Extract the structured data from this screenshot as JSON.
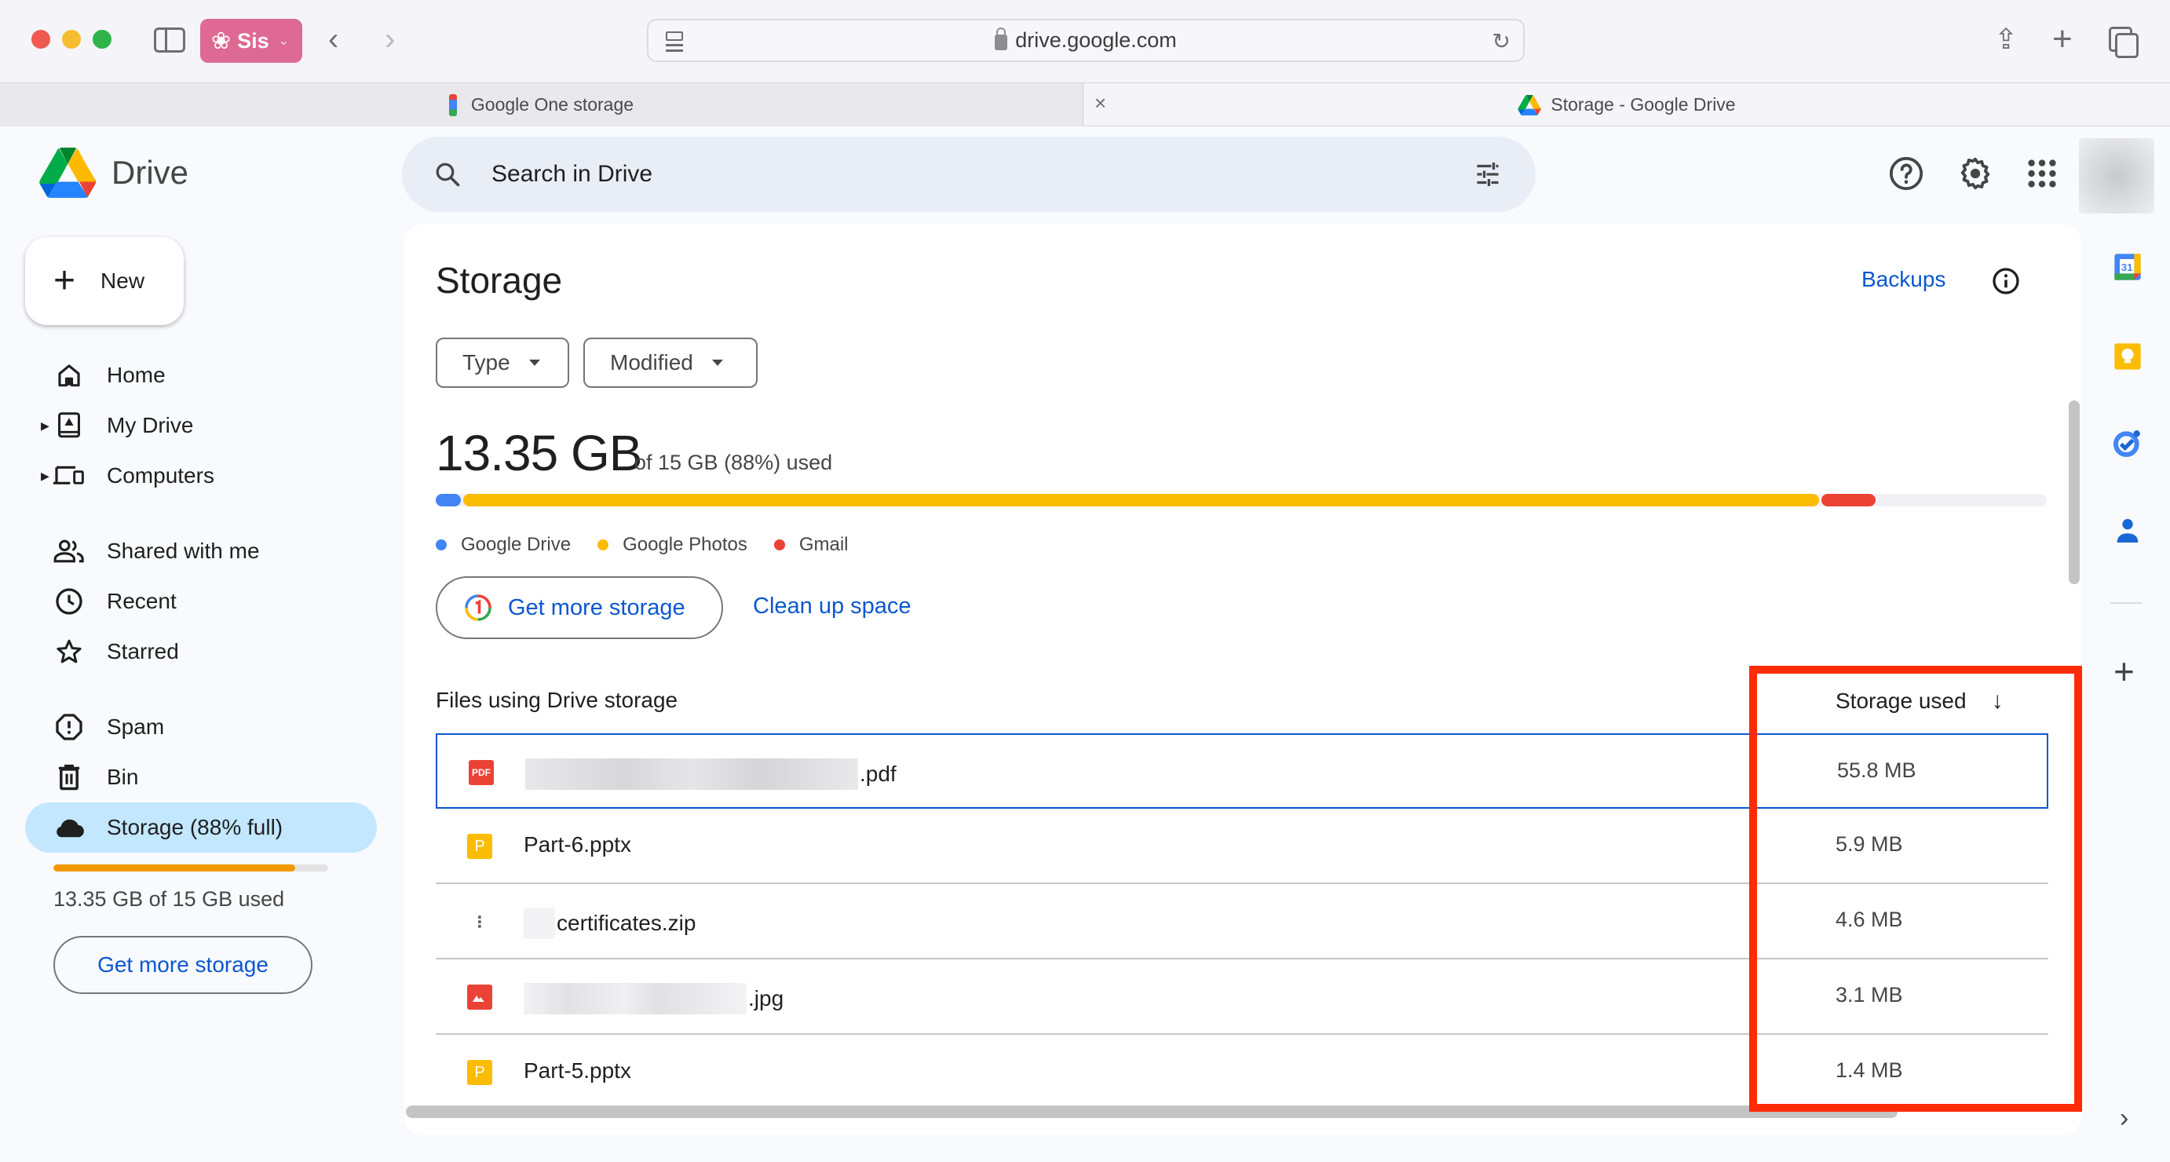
{
  "browser": {
    "profile_label": "Sis",
    "url": "drive.google.com",
    "tabs": [
      {
        "title": "Google One storage",
        "active": false
      },
      {
        "title": "Storage - Google Drive",
        "active": true
      }
    ],
    "close_tab_glyph": "×"
  },
  "app": {
    "name": "Drive",
    "search_placeholder": "Search in Drive"
  },
  "sidebar": {
    "new_label": "New",
    "items": [
      {
        "label": "Home",
        "icon": "home-icon"
      },
      {
        "label": "My Drive",
        "icon": "my-drive-icon",
        "expandable": true
      },
      {
        "label": "Computers",
        "icon": "computers-icon",
        "expandable": true
      },
      {
        "label": "Shared with me",
        "icon": "shared-icon"
      },
      {
        "label": "Recent",
        "icon": "clock-icon"
      },
      {
        "label": "Starred",
        "icon": "star-icon"
      },
      {
        "label": "Spam",
        "icon": "spam-icon"
      },
      {
        "label": "Bin",
        "icon": "trash-icon"
      },
      {
        "label": "Storage (88% full)",
        "icon": "cloud-icon",
        "active": true
      }
    ],
    "storage_used_fraction": 0.88,
    "storage_text": "13.35 GB of 15 GB used",
    "get_more_storage_label": "Get more storage"
  },
  "main": {
    "title": "Storage",
    "backups_label": "Backups",
    "filters": [
      {
        "label": "Type"
      },
      {
        "label": "Modified"
      }
    ],
    "used_amount": "13.35 GB",
    "used_detail": "of 15 GB (88%) used",
    "usage_breakdown": [
      {
        "name": "Google Drive",
        "color": "#4285f4",
        "fraction": 0.017
      },
      {
        "name": "Google Photos",
        "color": "#fbbc04",
        "fraction": 0.843
      },
      {
        "name": "Gmail",
        "color": "#ea4335",
        "fraction": 0.035
      }
    ],
    "get_more_storage_label": "Get more storage",
    "clean_up_label": "Clean up space",
    "files_header": "Files using Drive storage",
    "storage_column_header": "Storage used",
    "sort_direction_glyph": "↓",
    "files": [
      {
        "name_visible": ".pdf",
        "name_redacted": true,
        "type": "pdf",
        "size": "55.8 MB",
        "selected": true
      },
      {
        "name_visible": "Part-6.pptx",
        "name_redacted": false,
        "type": "pptx",
        "size": "5.9 MB"
      },
      {
        "name_visible": "certificates.zip",
        "name_redacted": true,
        "type": "zip",
        "size": "4.6 MB"
      },
      {
        "name_visible": ".jpg",
        "name_redacted": true,
        "type": "image",
        "size": "3.1 MB"
      },
      {
        "name_visible": "Part-5.pptx",
        "name_redacted": false,
        "type": "pptx",
        "size": "1.4 MB"
      }
    ]
  },
  "annotation": {
    "highlight_color": "#ff2a06",
    "highlighted_region": "Storage used column"
  },
  "colors": {
    "accent_blue": "#0b57d0",
    "active_nav_bg": "#c2e7ff",
    "sidebar_bar": "#f29900"
  }
}
